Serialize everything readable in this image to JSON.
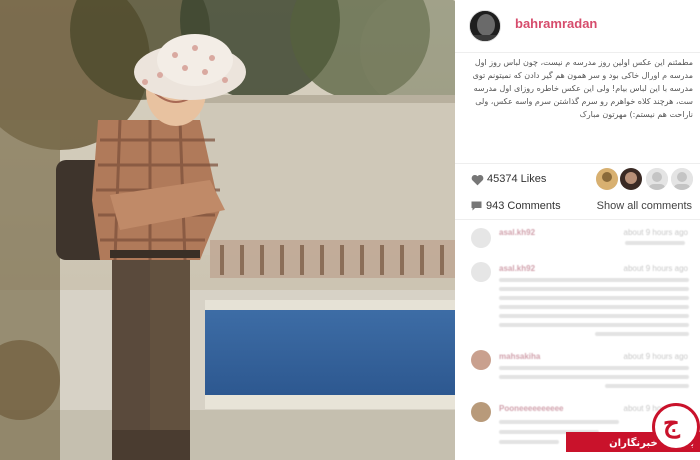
{
  "post": {
    "username": "bahramradan",
    "caption": "مطمئنم این عکس اولین روز مدرسه م نیست، چون لباس روز اول مدرسه م اورال خاکی بود و سر همون هم گیر دادن که نمیتونم توی مدرسه با این لباس بیام! ولی این عکس خاطره روزای اول مدرسه ست، هرچند کلاه خواهرم رو سرم گذاشتن سرم واسه عکس، ولی ناراحت هم نیستم:) مهرتون مبارک",
    "likes_label": "45374 Likes",
    "comments_label": "943 Comments",
    "show_all_label": "Show all comments"
  },
  "icons": {
    "heart": "heart-icon",
    "comment": "comment-icon"
  },
  "comments": [
    {
      "user": "asal.kh92",
      "time": "about 9 hours ago"
    },
    {
      "user": "asal.kh92",
      "time": "about 9 hours ago"
    },
    {
      "user": "mahsakiha",
      "time": "about 9 hours ago"
    },
    {
      "user": "Pooneeeeeeeeee",
      "time": "about 9 hours ago"
    }
  ],
  "watermark": {
    "text": "باشگاه خبرنگاران",
    "glyph": "ج"
  },
  "colors": {
    "username": "#d64c6c",
    "brand_red": "#c9122b"
  }
}
